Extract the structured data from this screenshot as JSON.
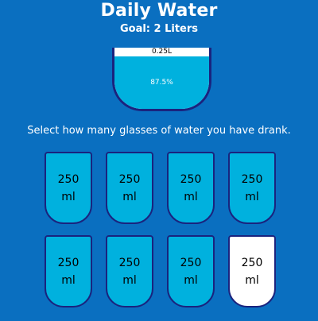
{
  "header": {
    "title": "Daily Water",
    "goal": "Goal: 2 Liters"
  },
  "cup": {
    "remained": "0.25L",
    "percentage_label": "87.5%",
    "percentage": 87.5
  },
  "instruction": "Select how many glasses of water you have drank.",
  "glasses": [
    {
      "amount": "250",
      "unit": "ml",
      "full": true
    },
    {
      "amount": "250",
      "unit": "ml",
      "full": true
    },
    {
      "amount": "250",
      "unit": "ml",
      "full": true
    },
    {
      "amount": "250",
      "unit": "ml",
      "full": true
    },
    {
      "amount": "250",
      "unit": "ml",
      "full": true
    },
    {
      "amount": "250",
      "unit": "ml",
      "full": true
    },
    {
      "amount": "250",
      "unit": "ml",
      "full": true
    },
    {
      "amount": "250",
      "unit": "ml",
      "full": false
    }
  ],
  "colors": {
    "background": "#0a6fc0",
    "water": "#00b1de",
    "border": "#1a237e",
    "empty": "#ffffff"
  }
}
